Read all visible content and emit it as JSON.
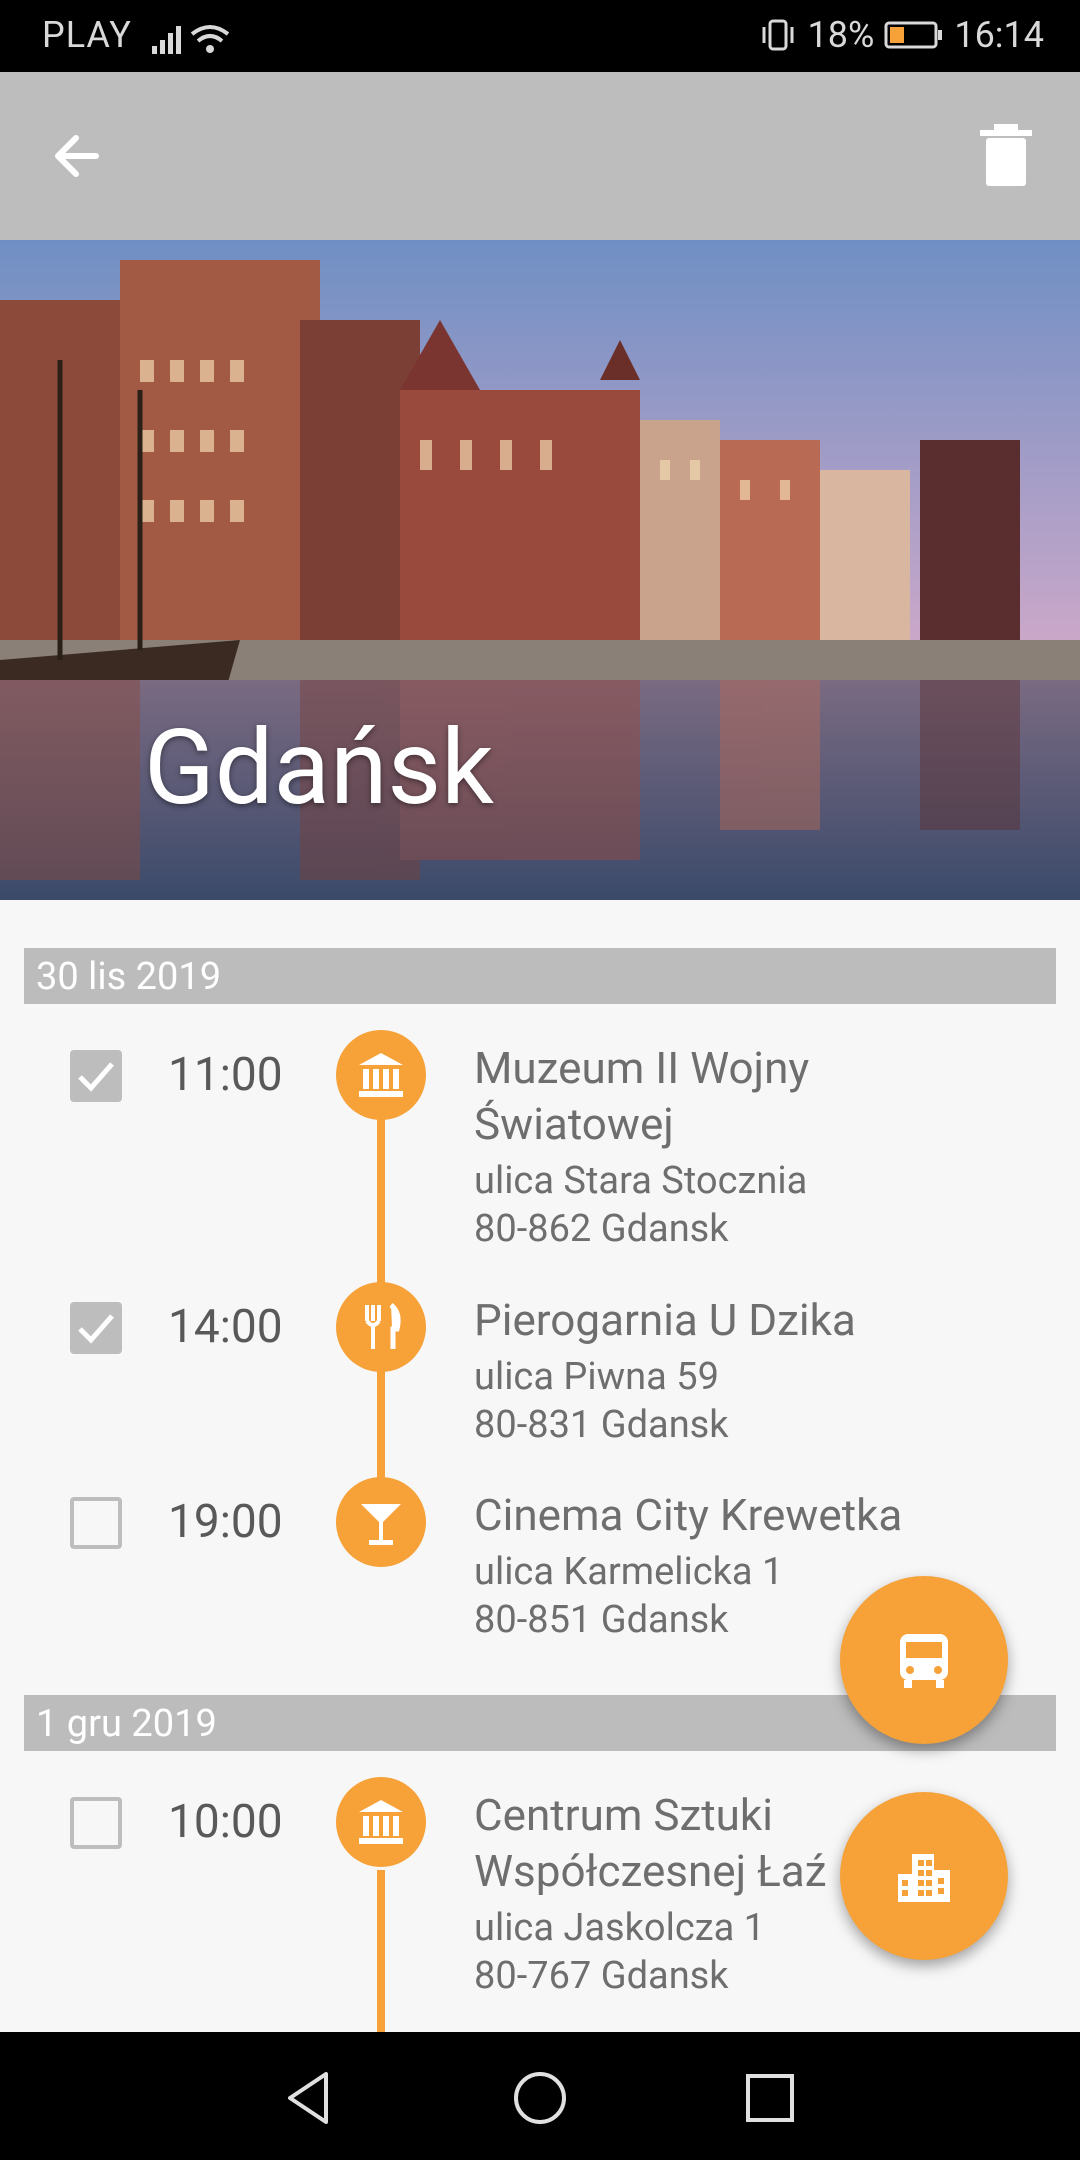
{
  "status_bar": {
    "carrier": "PLAY",
    "battery_percent": "18%",
    "time": "16:14"
  },
  "hero": {
    "city": "Gdańsk"
  },
  "days": [
    {
      "date": "30 lis 2019",
      "items": [
        {
          "checked": true,
          "time": "11:00",
          "icon": "museum-icon",
          "name_line1": "Muzeum II Wojny",
          "name_line2": "Światowej",
          "street": "ulica Stara Stocznia",
          "city_line": "80-862 Gdansk"
        },
        {
          "checked": true,
          "time": "14:00",
          "icon": "restaurant-icon",
          "name_line1": "Pierogarnia U Dzika",
          "name_line2": "",
          "street": "ulica Piwna 59",
          "city_line": "80-831 Gdansk"
        },
        {
          "checked": false,
          "time": "19:00",
          "icon": "cocktail-icon",
          "name_line1": "Cinema City Krewetka",
          "name_line2": "",
          "street": "ulica Karmelicka 1",
          "city_line": "80-851 Gdansk"
        }
      ]
    },
    {
      "date": "1 gru 2019",
      "items": [
        {
          "checked": false,
          "time": "10:00",
          "icon": "museum-icon",
          "name_line1": "Centrum Sztuki",
          "name_line2": "Współczesnej Łaź",
          "street": "ulica Jaskolcza 1",
          "city_line": "80-767 Gdansk"
        }
      ]
    }
  ],
  "fabs": [
    {
      "icon": "bus-icon"
    },
    {
      "icon": "hotel-icon"
    }
  ],
  "colors": {
    "accent": "#f7a139",
    "app_bar": "#bdbdbd",
    "text": "#6e6e6e"
  }
}
